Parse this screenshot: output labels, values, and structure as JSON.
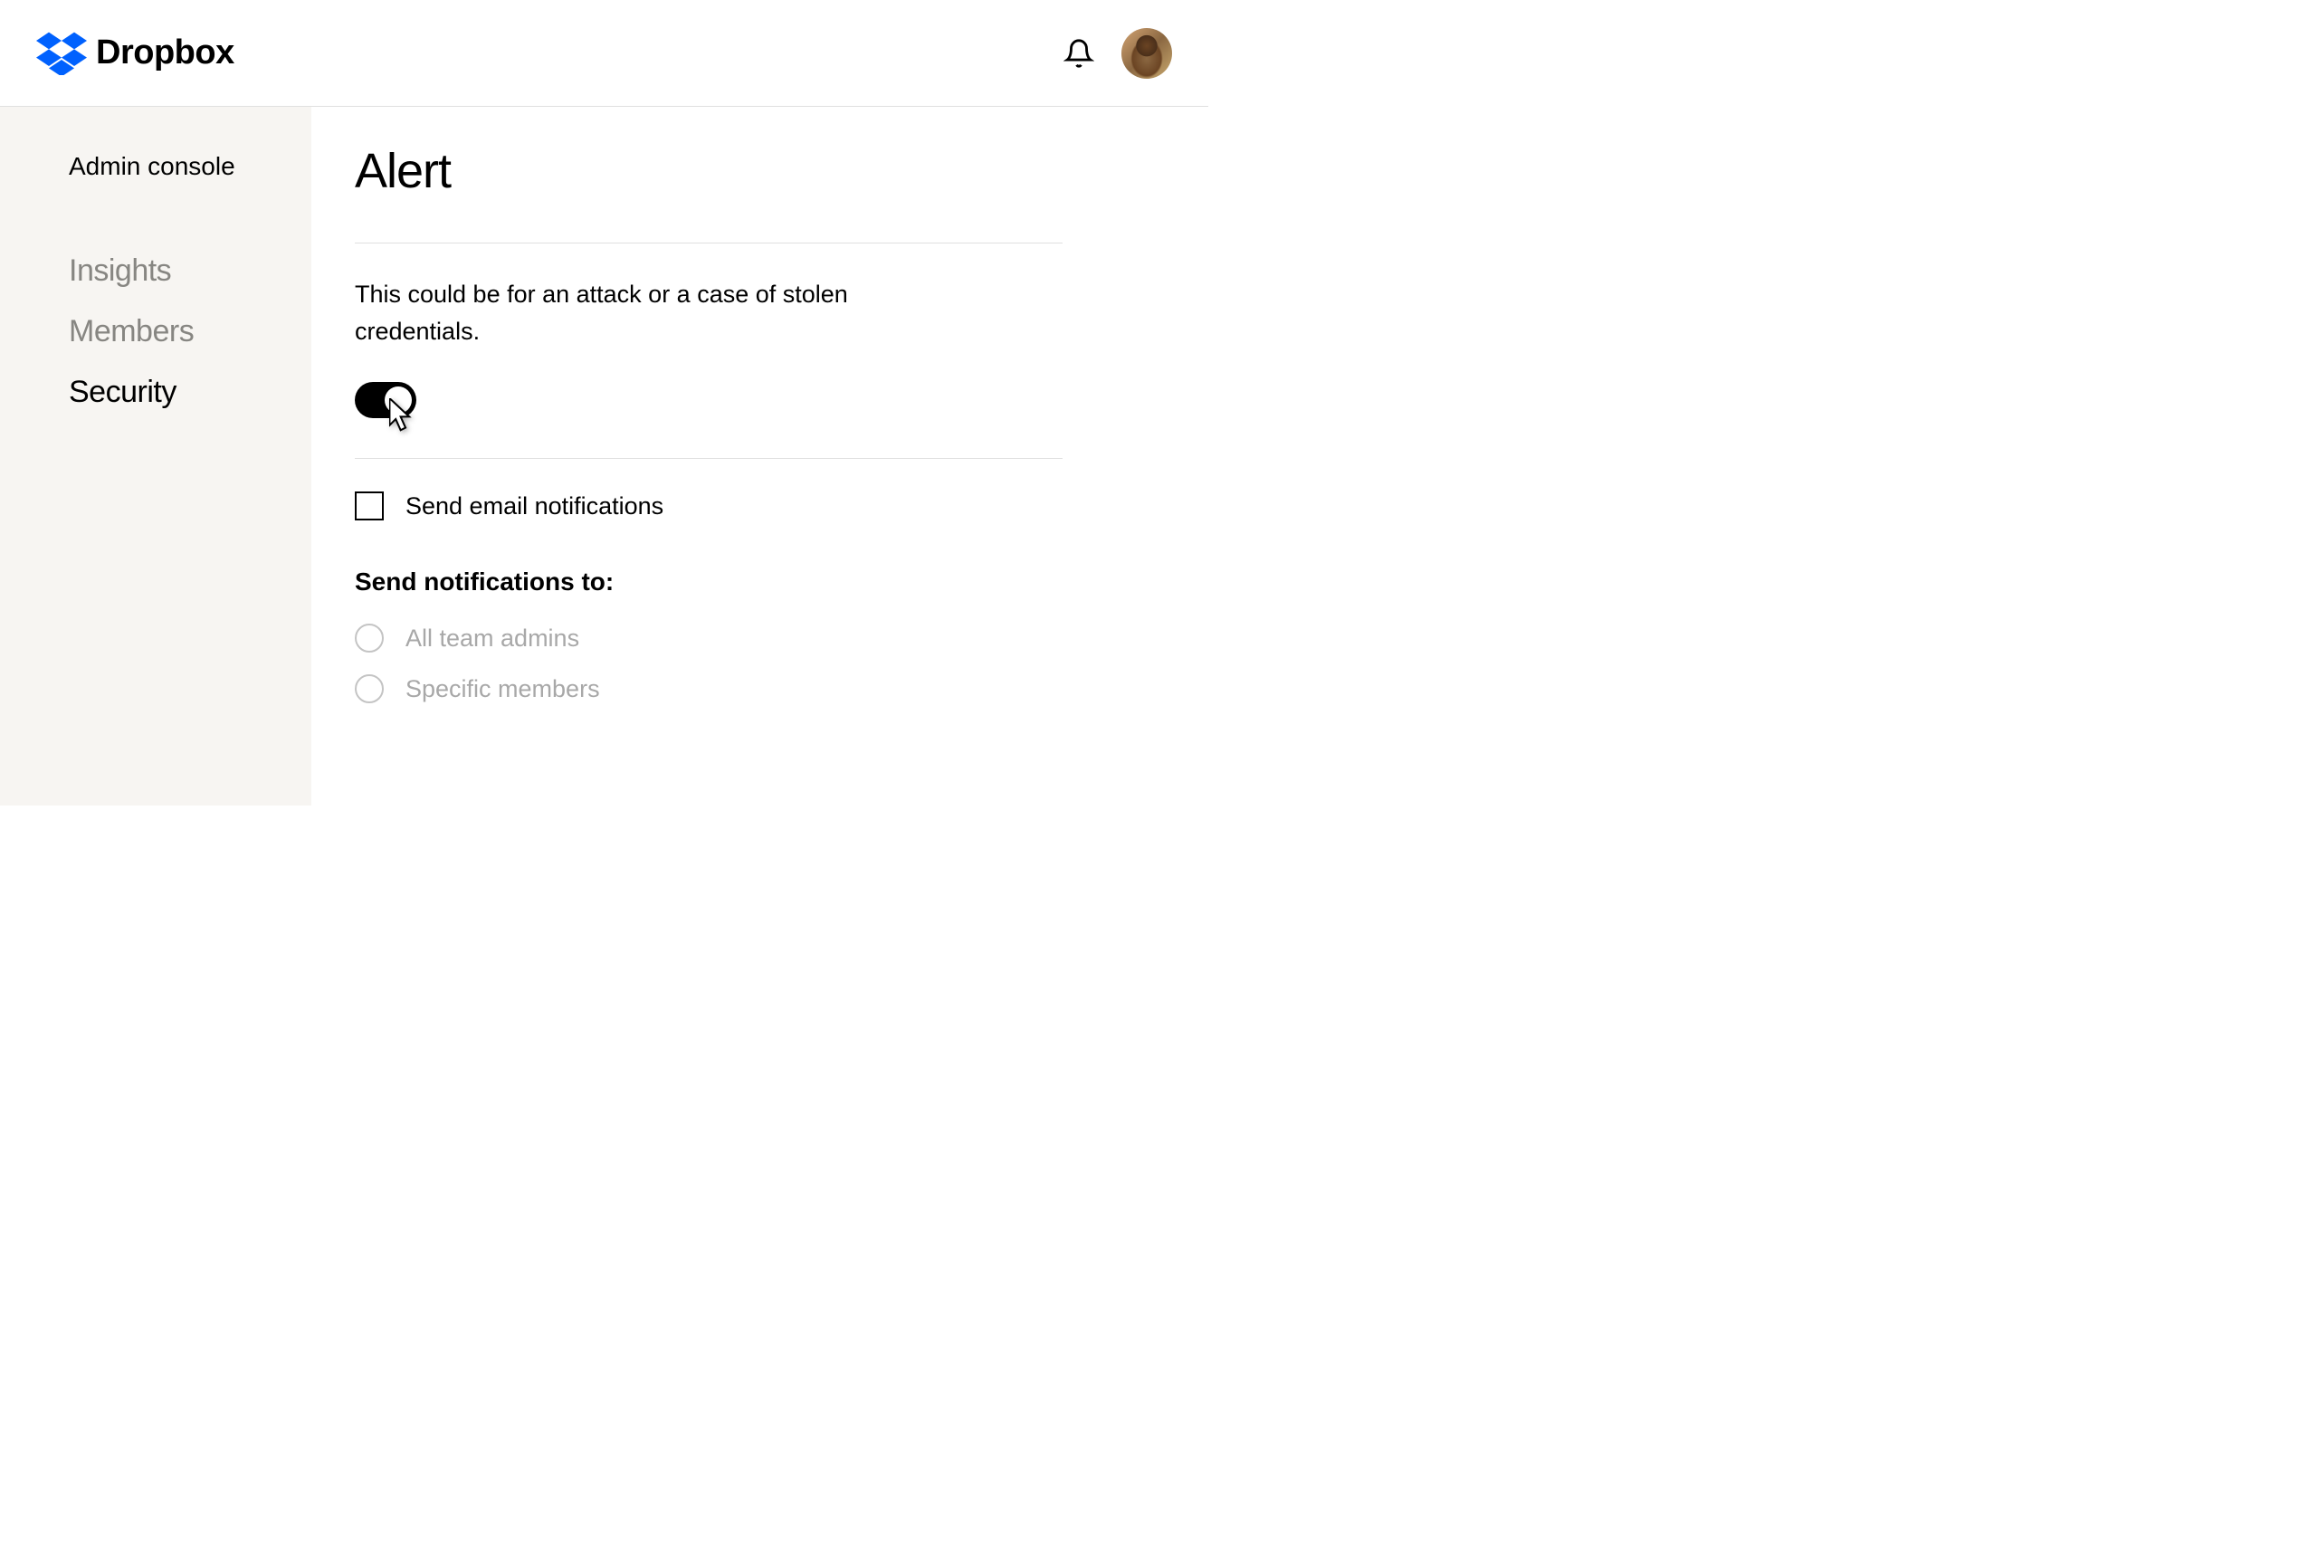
{
  "header": {
    "brand": "Dropbox"
  },
  "sidebar": {
    "title": "Admin console",
    "items": [
      {
        "label": "Insights",
        "active": false
      },
      {
        "label": "Members",
        "active": false
      },
      {
        "label": "Security",
        "active": true
      }
    ]
  },
  "main": {
    "title": "Alert",
    "description": "This could be for an attack or a case of stolen credentials.",
    "toggleOn": true,
    "checkbox": {
      "label": "Send email notifications",
      "checked": false
    },
    "notificationsHeading": "Send notifications to:",
    "radioOptions": [
      {
        "label": "All team admins"
      },
      {
        "label": "Specific members"
      }
    ]
  }
}
